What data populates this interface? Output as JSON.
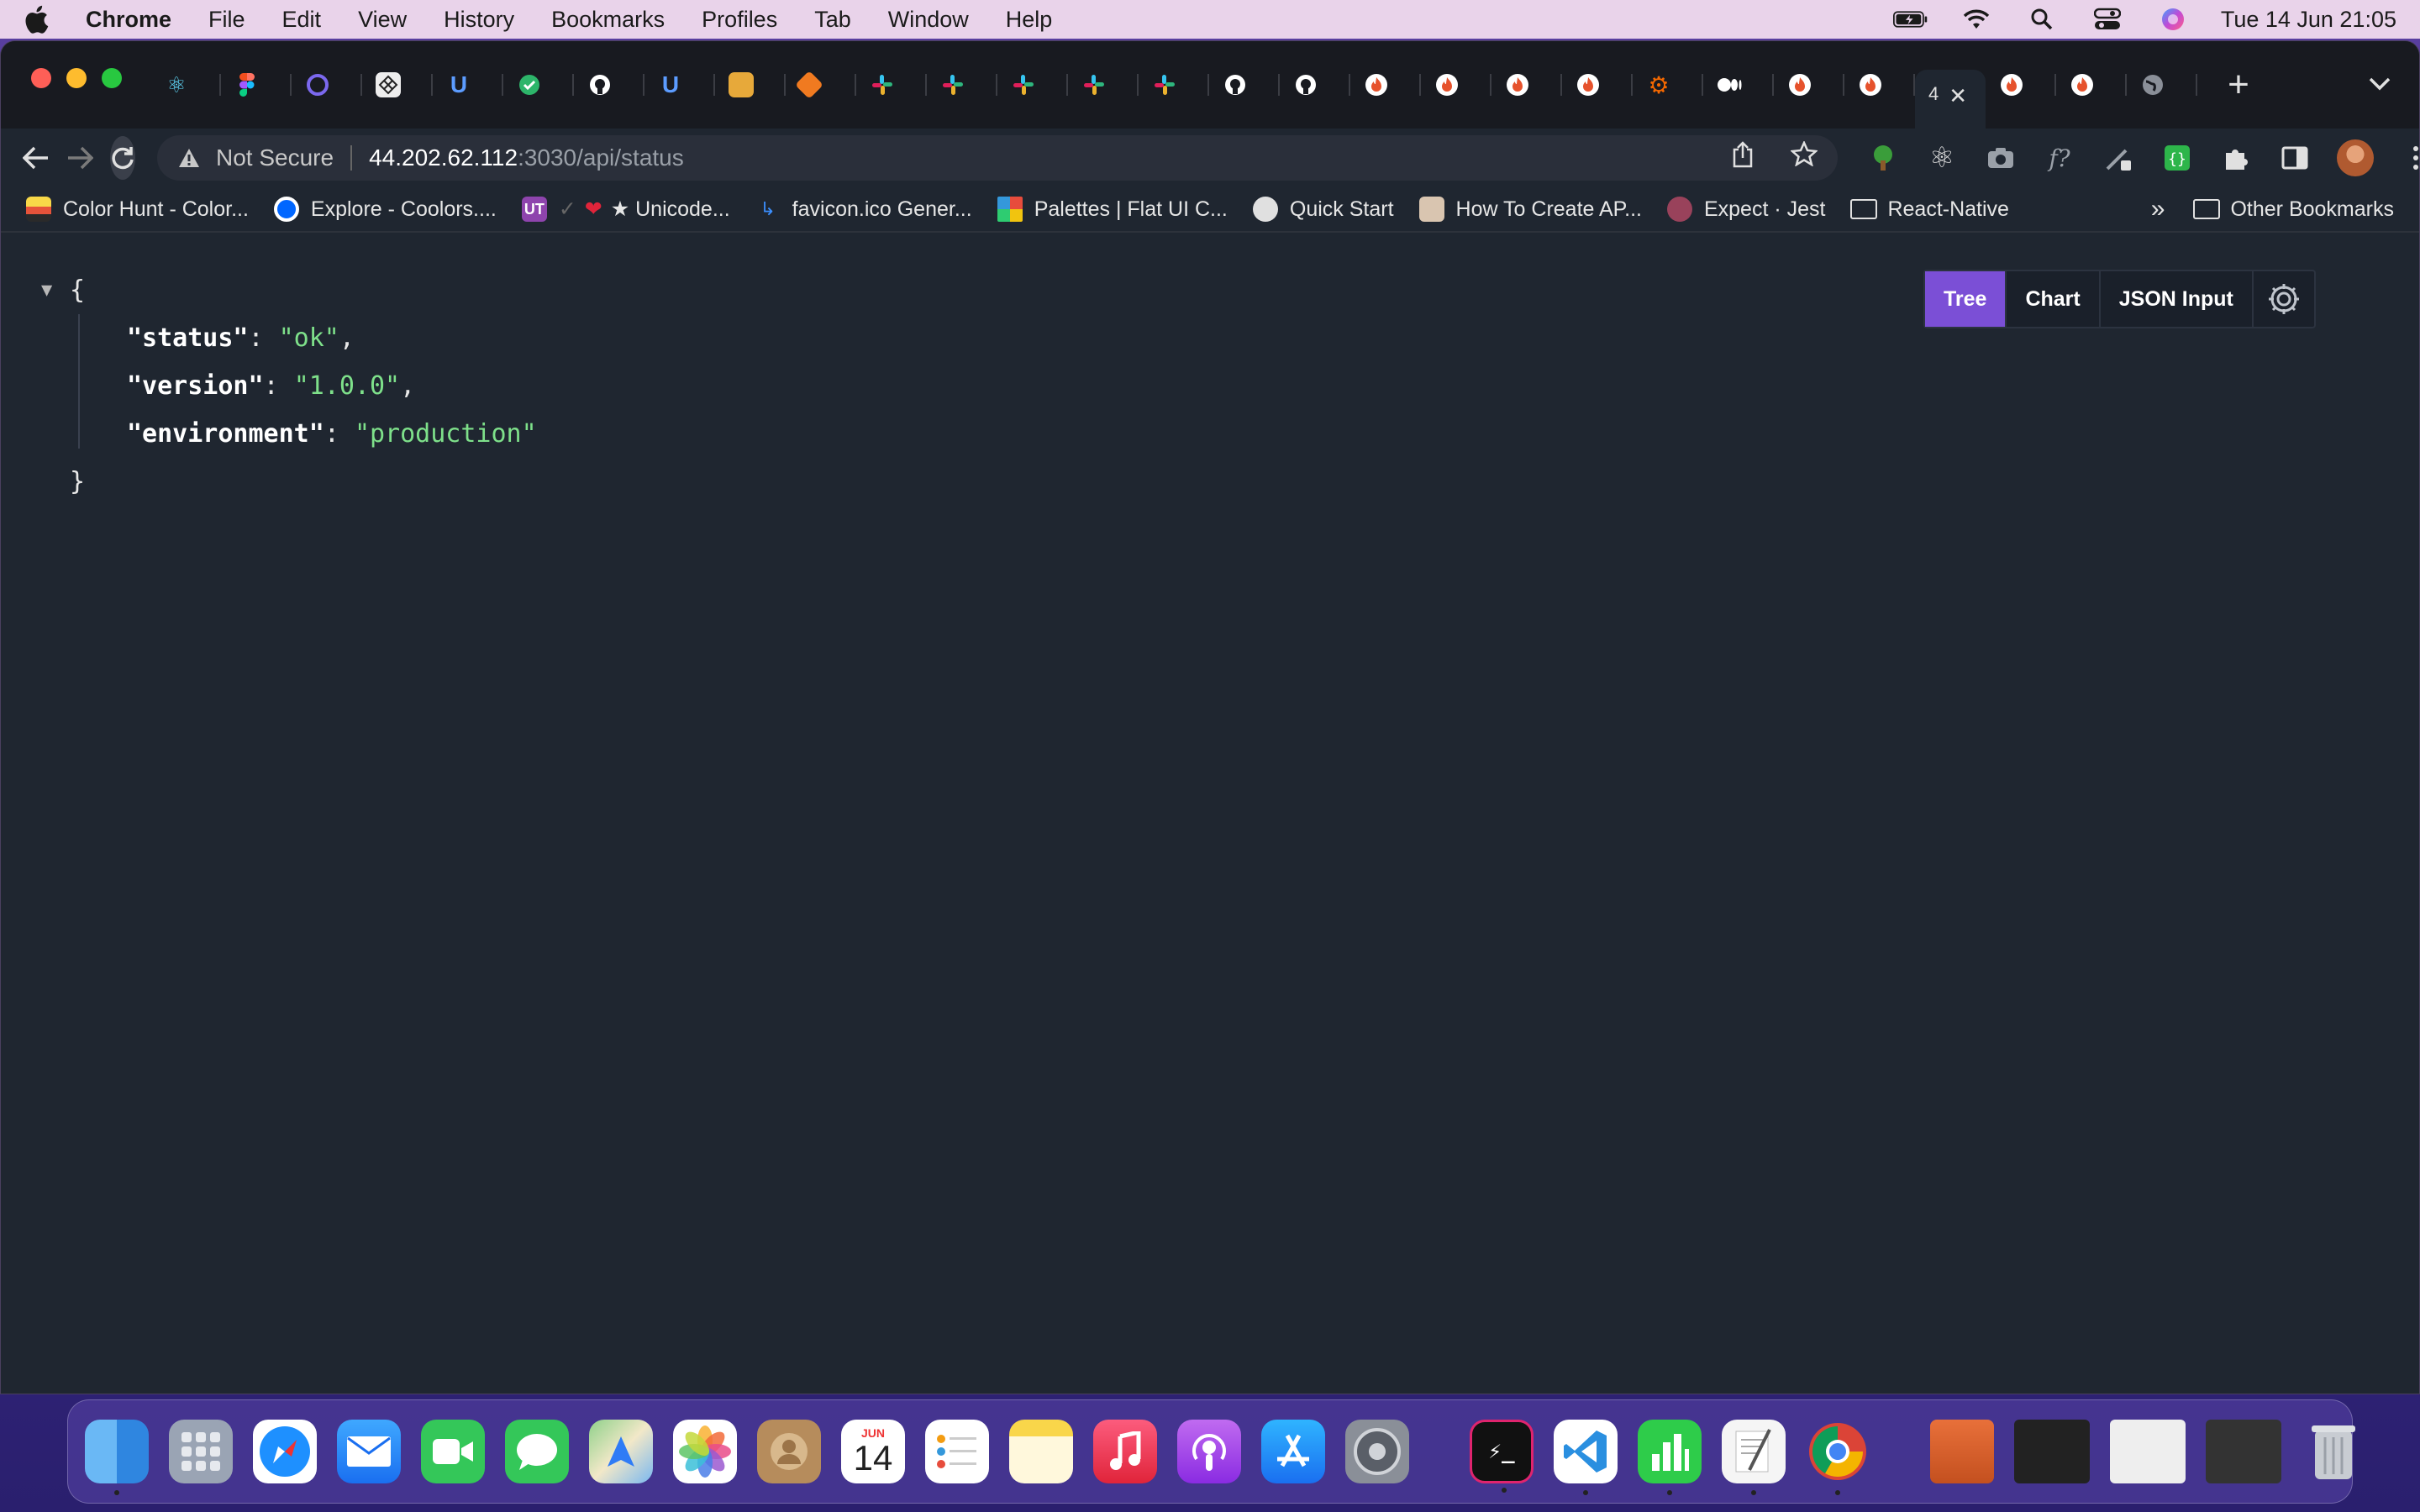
{
  "menubar": {
    "app_name": "Chrome",
    "items": [
      "File",
      "Edit",
      "View",
      "History",
      "Bookmarks",
      "Profiles",
      "Tab",
      "Window",
      "Help"
    ],
    "datetime": "Tue 14 Jun  21:05"
  },
  "tabs": {
    "active_label": "4",
    "close_glyph": "✕",
    "new_tab_glyph": "+",
    "menu_glyph": "⌄"
  },
  "toolbar": {
    "security_label": "Not Secure",
    "url_host": "44.202.62.112",
    "url_path": ":3030/api/status"
  },
  "bookmarks": {
    "items": [
      "Color Hunt - Color...",
      "Explore - Coolors....",
      "★ Unicode...",
      "favicon.ico Gener...",
      "Palettes | Flat UI C...",
      "Quick Start",
      "How To Create AP...",
      "Expect · Jest",
      "React-Native"
    ],
    "more": "»",
    "other": "Other Bookmarks"
  },
  "json_viewer": {
    "open_brace": "{",
    "close_brace": "}",
    "toggle": "▼",
    "entries": [
      {
        "key": "\"status\"",
        "value": "\"ok\"",
        "comma": ","
      },
      {
        "key": "\"version\"",
        "value": "\"1.0.0\"",
        "comma": ","
      },
      {
        "key": "\"environment\"",
        "value": "\"production\"",
        "comma": ""
      }
    ],
    "view_tabs": [
      "Tree",
      "Chart",
      "JSON Input"
    ],
    "active_view": "Tree"
  },
  "dock": {
    "calendar_month": "JUN",
    "calendar_day": "14"
  },
  "colors": {
    "accent": "#7b4fd6",
    "json_string": "#7ee08a",
    "page_bg": "#1f2630"
  }
}
